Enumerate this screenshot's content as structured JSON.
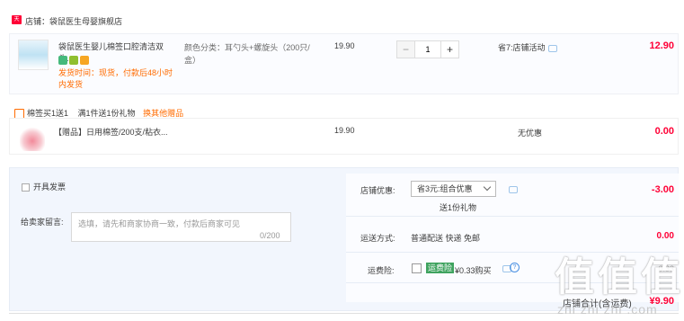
{
  "store": {
    "badge": "天猫",
    "label": "店铺：袋鼠医生母婴旗舰店"
  },
  "item1": {
    "title": "袋鼠医生婴儿棉签口腔清洁双头...",
    "shipping": "发货时间：现货，付款后48小时内发货",
    "spec": "颜色分类：耳勺头+螺旋头（200只/盒）",
    "price": "19.90",
    "quantity": "1",
    "minus_label": "−",
    "plus_label": "+",
    "promo": "省7:店铺活动",
    "total": "12.90"
  },
  "gift_bar": {
    "label": "棉签买1送1",
    "rule": "满1件送1份礼物",
    "link": "换其他赠品"
  },
  "item2": {
    "title": "【赠品】日用棉签/200支/粘衣...",
    "price": "19.90",
    "promo": "无优惠",
    "total": "0.00"
  },
  "order": {
    "invoice_label": "开具发票",
    "message_label": "给卖家留言:",
    "message_placeholder": "选填，请先和商家协商一致，付款后商家可见",
    "message_count": "0/200",
    "shop_discount_label": "店铺优惠:",
    "shop_discount_select": "省3元:组合优惠",
    "gift_note": "送1份礼物",
    "shop_discount_value": "-3.00",
    "shipping_label": "运送方式:",
    "shipping_value": "普通配送 快递 免邮",
    "shipping_amount": "0.00",
    "insurance_label": "运费险:",
    "insurance_tag": "运费险",
    "insurance_price": "¥0.33购买",
    "insurance_amount": "0.33",
    "subtotal_label": "店铺合计(含运费)",
    "subtotal_value": "¥9.90"
  },
  "watermark": {
    "big": "值值值",
    "small": "zhi zhi zhi .com"
  },
  "colors": {
    "accent": "#ff0036",
    "orange": "#ff6b00",
    "pane": "#f2f6fd"
  }
}
